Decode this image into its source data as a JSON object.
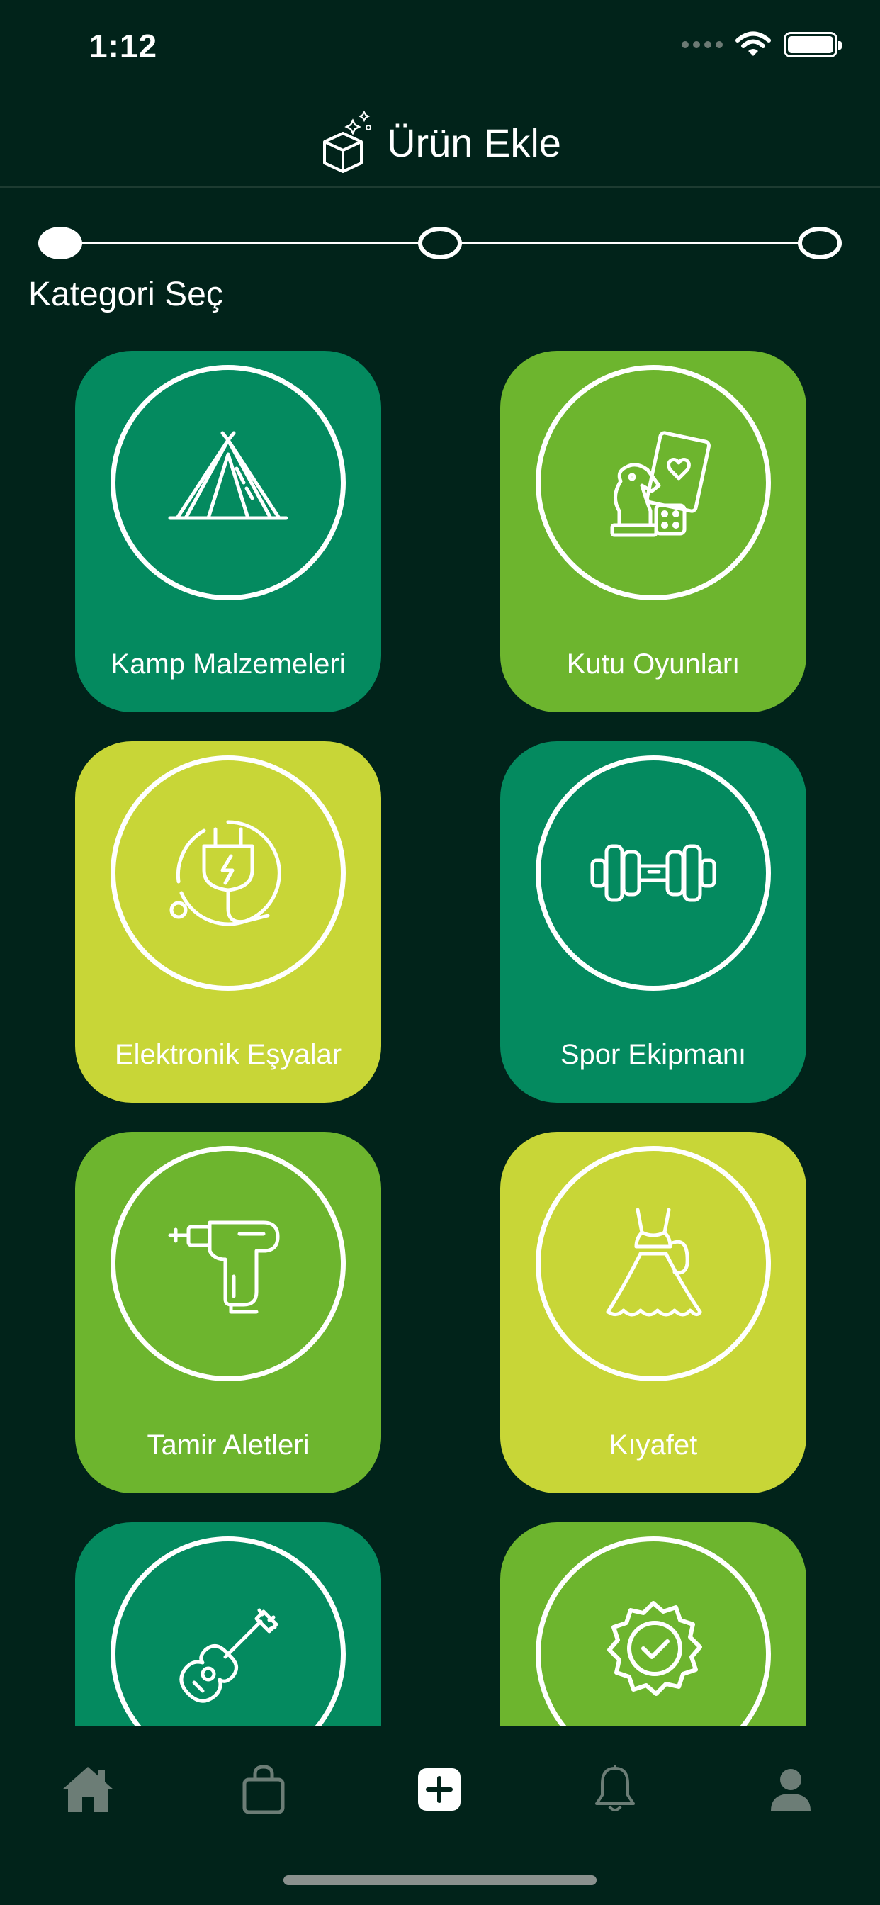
{
  "status_bar": {
    "time": "1:12"
  },
  "header": {
    "title": "Ürün Ekle",
    "icon": "box-sparkle-icon"
  },
  "stepper": {
    "current_step": 1,
    "total_steps": 3
  },
  "section": {
    "title": "Kategori Seç"
  },
  "categories": [
    {
      "label": "Kamp Malzemeleri",
      "icon": "tent-icon",
      "color": "#048a5f"
    },
    {
      "label": "Kutu Oyunları",
      "icon": "board-games-icon",
      "color": "#6db52e"
    },
    {
      "label": "Elektronik Eşyalar",
      "icon": "electric-plug-icon",
      "color": "#c8d637"
    },
    {
      "label": "Spor Ekipmanı",
      "icon": "dumbbell-icon",
      "color": "#048a5f"
    },
    {
      "label": "Tamir Aletleri",
      "icon": "drill-icon",
      "color": "#6db52e"
    },
    {
      "label": "Kıyafet",
      "icon": "dress-icon",
      "color": "#c8d637"
    },
    {
      "label": "",
      "icon": "guitar-icon",
      "color": "#048a5f"
    },
    {
      "label": "",
      "icon": "quality-badge-icon",
      "color": "#6db52e"
    }
  ],
  "tab_bar": {
    "items": [
      {
        "name": "home",
        "icon": "home-icon"
      },
      {
        "name": "bag",
        "icon": "shopping-bag-icon"
      },
      {
        "name": "add",
        "icon": "plus-icon",
        "selected": true
      },
      {
        "name": "notifications",
        "icon": "bell-icon"
      },
      {
        "name": "profile",
        "icon": "user-icon"
      }
    ]
  }
}
